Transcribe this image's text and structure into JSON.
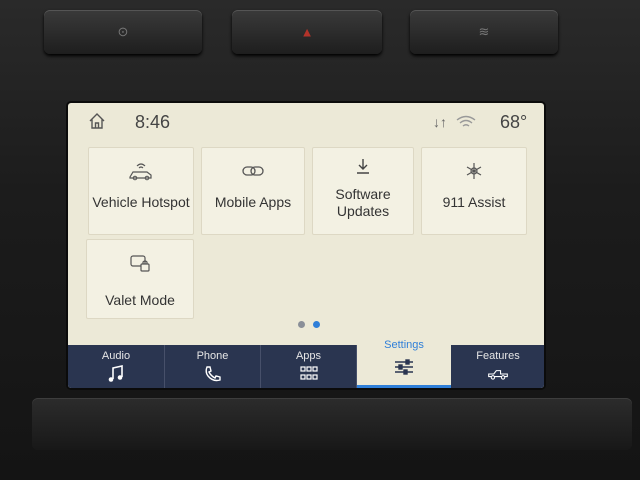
{
  "hardware": {
    "buttons": [
      {
        "icon": "defrost-icon"
      },
      {
        "icon": "hazard-icon"
      },
      {
        "icon": "rear-defrost-icon"
      }
    ]
  },
  "status": {
    "time": "8:46",
    "temperature": "68°",
    "home_icon": "home-icon",
    "signal_icon": "data-arrows-icon",
    "wifi_icon": "wifi-icon"
  },
  "tiles": [
    {
      "label": "Vehicle Hotspot",
      "icon": "hotspot-icon"
    },
    {
      "label": "Mobile Apps",
      "icon": "link-icon"
    },
    {
      "label": "Software Updates",
      "icon": "download-icon"
    },
    {
      "label": "911 Assist",
      "icon": "assist-icon"
    },
    {
      "label": "Valet Mode",
      "icon": "valet-lock-icon"
    }
  ],
  "pagination": {
    "count": 2,
    "active": 2,
    "inactive_color": "#8a8f98",
    "active_color": "#2f7fd8"
  },
  "nav": {
    "tabs": [
      {
        "label": "Audio",
        "icon": "music-note-icon"
      },
      {
        "label": "Phone",
        "icon": "phone-icon"
      },
      {
        "label": "Apps",
        "icon": "apps-grid-icon"
      },
      {
        "label": "Settings",
        "icon": "sliders-icon",
        "active": true
      },
      {
        "label": "Features",
        "icon": "truck-icon"
      }
    ],
    "bar_color": "#2a3550",
    "accent": "#2f7fd8"
  }
}
